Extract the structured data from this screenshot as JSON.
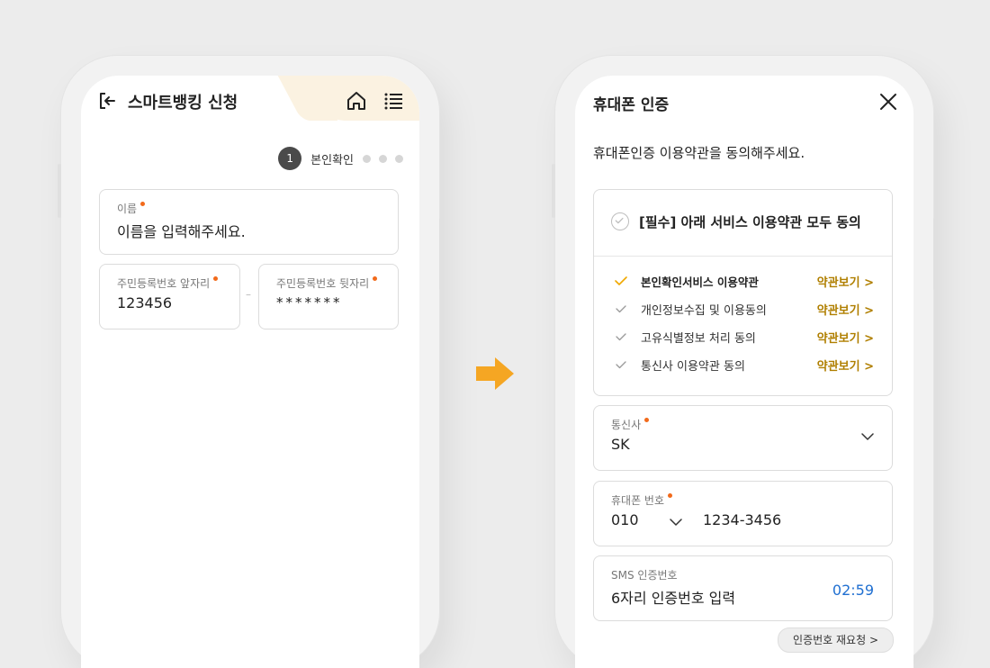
{
  "phone1": {
    "title": "스마트뱅킹 신청",
    "icons": [
      "logout-icon",
      "home-icon",
      "menu-list-icon"
    ],
    "step": {
      "number": "1",
      "label": "본인확인",
      "remaining_dots": 3
    },
    "name_field": {
      "label": "이름",
      "placeholder": "이름을 입력해주세요."
    },
    "rrn_front": {
      "label": "주민등록번호 앞자리",
      "value": "123456"
    },
    "rrn_sep": "–",
    "rrn_back": {
      "label": "주민등록번호 뒷자리",
      "value": "*******"
    }
  },
  "phone2": {
    "title": "휴대폰 인증",
    "subtitle": "휴대폰인증 이용약관을 동의해주세요.",
    "agree_all": "[필수] 아래 서비스 이용약관 모두 동의",
    "terms": [
      {
        "label": "본인확인서비스 이용약관",
        "view": "약관보기 >",
        "checked": true
      },
      {
        "label": "개인정보수집 및 이용동의",
        "view": "약관보기 >",
        "checked": false
      },
      {
        "label": "고유식별정보 처리 동의",
        "view": "약관보기 >",
        "checked": false
      },
      {
        "label": "통신사 이용약관 동의",
        "view": "약관보기 >",
        "checked": false
      }
    ],
    "carrier": {
      "label": "통신사",
      "value": "SK"
    },
    "phone": {
      "label": "휴대폰 번호",
      "prefix": "010",
      "number": "1234-3456"
    },
    "sms": {
      "label": "SMS 인증번호",
      "placeholder": "6자리 인증번호 입력",
      "timer": "02:59"
    },
    "resend_label": "인증번호 재요청 >"
  },
  "colors": {
    "required_dot": "#f26a1b",
    "accent_check": "#f0a800",
    "link_gold": "#b07f00",
    "timer_blue": "#1f6fd1",
    "arrow_orange": "#f5a623"
  }
}
